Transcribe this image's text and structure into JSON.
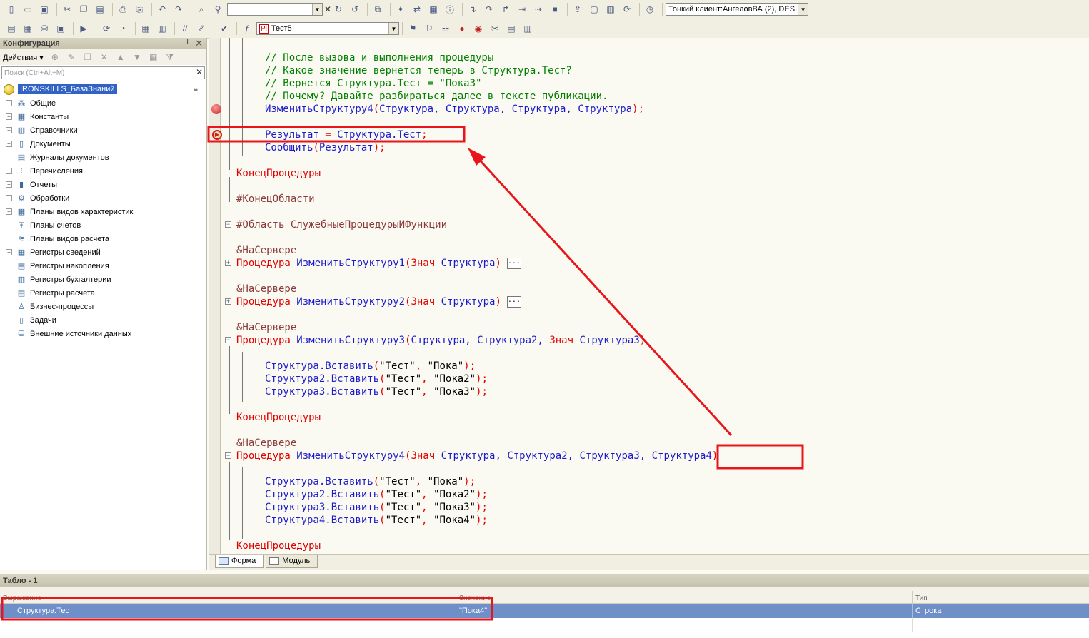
{
  "colors": {
    "accent_red": "#e8151b",
    "selection": "#6f8fc9",
    "code_comment": "#008000",
    "code_keyword": "#e00000",
    "code_identifier": "#1a1acc",
    "code_preprocessor": "#8b3a3a"
  },
  "toolbar1": {
    "client_combo": "Тонкий клиент:АнгеловВА (2), DESI",
    "search_combo": ""
  },
  "toolbar2": {
    "object_combo": "Тест5"
  },
  "config_panel": {
    "title": "Конфигурация",
    "actions_label": "Действия",
    "search_placeholder": "Поиск (Ctrl+Alt+M)",
    "root_label": "IRONSKILLS_БазаЗнаний",
    "items": [
      {
        "label": "Общие",
        "icon": "shapes-icon",
        "expandable": true
      },
      {
        "label": "Константы",
        "icon": "grid-icon",
        "expandable": true
      },
      {
        "label": "Справочники",
        "icon": "catalog-icon",
        "expandable": true
      },
      {
        "label": "Документы",
        "icon": "document-icon",
        "expandable": true
      },
      {
        "label": "Журналы документов",
        "icon": "journal-icon",
        "expandable": false
      },
      {
        "label": "Перечисления",
        "icon": "enum-icon",
        "expandable": true
      },
      {
        "label": "Отчеты",
        "icon": "report-icon",
        "expandable": true
      },
      {
        "label": "Обработки",
        "icon": "processing-icon",
        "expandable": true
      },
      {
        "label": "Планы видов характеристик",
        "icon": "chart-types-icon",
        "expandable": true
      },
      {
        "label": "Планы счетов",
        "icon": "accounts-icon",
        "expandable": false
      },
      {
        "label": "Планы видов расчета",
        "icon": "calc-types-icon",
        "expandable": false
      },
      {
        "label": "Регистры сведений",
        "icon": "info-register-icon",
        "expandable": true
      },
      {
        "label": "Регистры накопления",
        "icon": "accum-register-icon",
        "expandable": false
      },
      {
        "label": "Регистры бухгалтерии",
        "icon": "accounting-register-icon",
        "expandable": false
      },
      {
        "label": "Регистры расчета",
        "icon": "calc-register-icon",
        "expandable": false
      },
      {
        "label": "Бизнес-процессы",
        "icon": "business-process-icon",
        "expandable": false
      },
      {
        "label": "Задачи",
        "icon": "task-icon",
        "expandable": false
      },
      {
        "label": "Внешние источники данных",
        "icon": "external-source-icon",
        "expandable": false
      }
    ]
  },
  "code": {
    "c1": "// После вызова и выполнения процедуры",
    "c2": "// Какое значение вернется теперь в Структура.Тест?",
    "c3": "// Вернется Структура.Тест = \"Пока3\"",
    "c4": "// Почему? Давайте разбираться далее в тексте публикации.",
    "call4_name": "ИзменитьСтруктуру4",
    "call4_args": "Структура, Структура, Структура, Структура",
    "result_var": "Результат",
    "result_expr": "Структура.Тест",
    "report_fn": "Сообщить",
    "report_arg": "Результат",
    "end_proc": "КонецПроцедуры",
    "end_region": "#КонецОбласти",
    "region_start": "#Область",
    "region_name": "СлужебныеПроцедурыИФункции",
    "at_server": "&НаСервере",
    "proc_kw": "Процедура",
    "znach": "Знач",
    "p1_name": "ИзменитьСтруктуру1",
    "p1_param": "Структура",
    "p2_name": "ИзменитьСтруктуру2",
    "p2_param": "Структура",
    "p3_name": "ИзменитьСтруктуру3",
    "p3_params_a": "Структура, Структура2,",
    "p3_param_b": "Структура3",
    "p4_name": "ИзменитьСтруктуру4",
    "p4_params_a": "Структура, Структура2, Структура3,",
    "p4_param_b": "Структура4",
    "ins_s1": "Структура.Вставить",
    "ins_s2": "Структура2.Вставить",
    "ins_s3": "Структура3.Вставить",
    "ins_s4": "Структура4.Вставить",
    "key": "\"Тест\"",
    "v1": "\"Пока\"",
    "v2": "\"Пока2\"",
    "v3": "\"Пока3\"",
    "v4": "\"Пока4\"",
    "ellipsis": "..."
  },
  "tabs": [
    {
      "label": "Форма",
      "active": true
    },
    {
      "label": "Модуль",
      "active": false
    }
  ],
  "watch_panel": {
    "title": "Табло - 1",
    "col_expression": "Выражение",
    "col_value": "Значение",
    "col_type": "Тип",
    "row": {
      "expression": "Структура.Тест",
      "value": "\"Пока4\"",
      "type": "Строка"
    }
  }
}
